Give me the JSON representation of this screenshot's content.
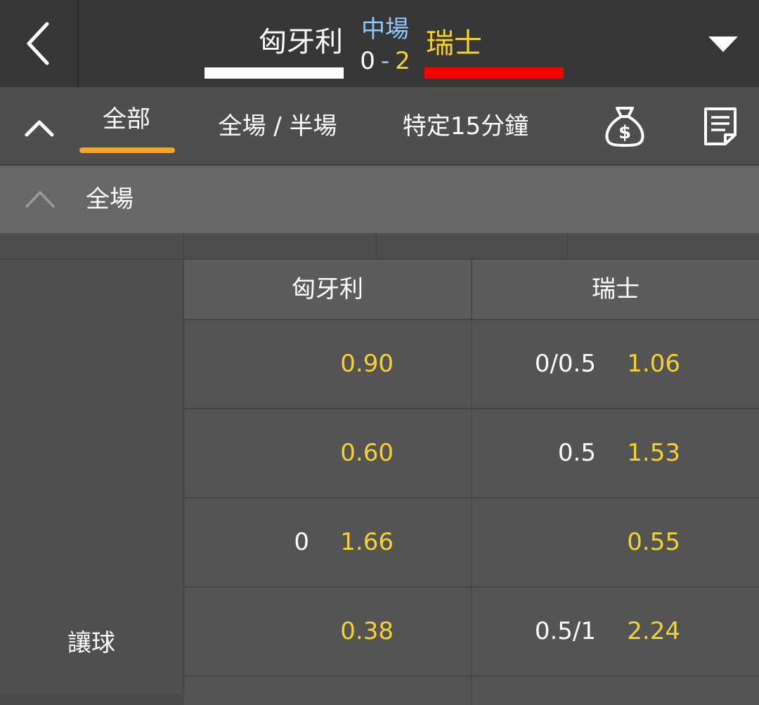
{
  "header": {
    "home_team": "匈牙利",
    "away_team": "瑞士",
    "status": "中場",
    "score_home": "0",
    "score_sep": "-",
    "score_away": "2",
    "home_color": "#ffffff",
    "away_color": "#ff0000"
  },
  "tabs": [
    {
      "label": "全部",
      "active": true
    },
    {
      "label": "全場 / 半場"
    },
    {
      "label": "特定15分鐘"
    }
  ],
  "section": {
    "title": "全場"
  },
  "market": {
    "label": "讓球",
    "columns": [
      "匈牙利",
      "瑞士"
    ],
    "rows": [
      {
        "home_line": "",
        "home_odds": "0.90",
        "away_line": "0/0.5",
        "away_odds": "1.06"
      },
      {
        "home_line": "",
        "home_odds": "0.60",
        "away_line": "0.5",
        "away_odds": "1.53"
      },
      {
        "home_line": "0",
        "home_odds": "1.66",
        "away_line": "",
        "away_odds": "0.55"
      },
      {
        "home_line": "",
        "home_odds": "0.38",
        "away_line": "0.5/1",
        "away_odds": "2.24"
      }
    ]
  },
  "icons": {
    "back": "chevron-left-icon",
    "dropdown": "caret-down-icon",
    "collapse": "chevron-up-icon",
    "money": "money-bag-icon",
    "doc": "document-icon"
  },
  "colors": {
    "accent": "#f5a623",
    "odds": "#f5d22e",
    "status": "#8fc8ff"
  }
}
